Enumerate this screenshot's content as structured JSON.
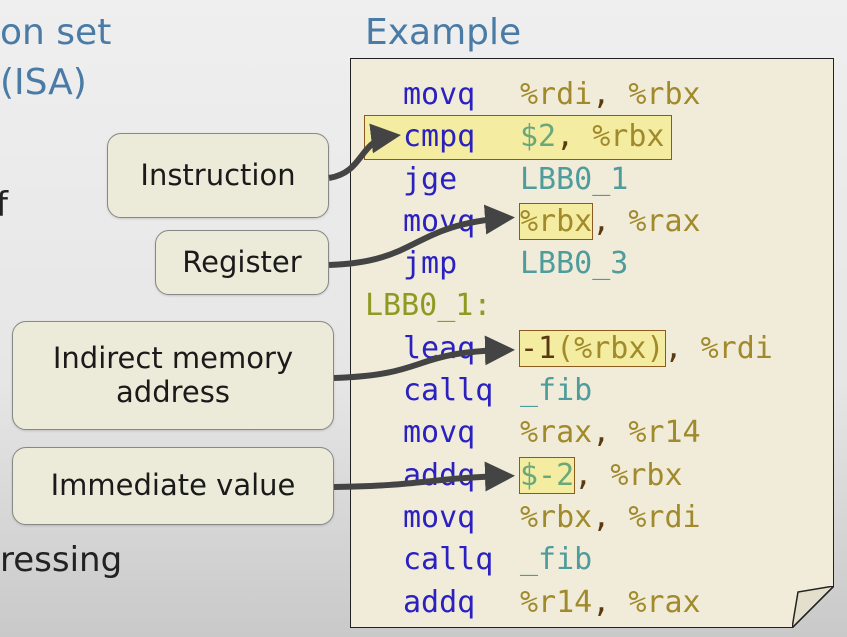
{
  "slide": {
    "left_fragments": [
      "on set",
      "(ISA)",
      "f",
      "ressing"
    ],
    "example_title": "Example"
  },
  "callouts": [
    {
      "label": "Instruction"
    },
    {
      "label": "Register"
    },
    {
      "label": "Indirect memory address"
    },
    {
      "label": "Immediate value"
    }
  ],
  "code": [
    {
      "mnemonic": "movq",
      "tokens": [
        {
          "t": "%rdi",
          "k": "reg"
        },
        {
          "t": ", ",
          "k": "punct"
        },
        {
          "t": "%rbx",
          "k": "reg"
        }
      ]
    },
    {
      "mnemonic": "cmpq",
      "highlight_line": true,
      "tokens": [
        {
          "t": "$2",
          "k": "imm"
        },
        {
          "t": ", ",
          "k": "punct"
        },
        {
          "t": "%rbx",
          "k": "reg"
        }
      ]
    },
    {
      "mnemonic": "jge",
      "tokens": [
        {
          "t": "LBB0_1",
          "k": "lbl"
        }
      ]
    },
    {
      "mnemonic": "movq",
      "tokens": [
        {
          "t": "%rbx",
          "k": "reg",
          "boxed": true
        },
        {
          "t": ", ",
          "k": "punct"
        },
        {
          "t": "%rax",
          "k": "reg"
        }
      ]
    },
    {
      "mnemonic": "jmp",
      "tokens": [
        {
          "t": "LBB0_3",
          "k": "lbl"
        }
      ]
    },
    {
      "label": "LBB0_1:"
    },
    {
      "mnemonic": "leaq",
      "tokens": [
        {
          "t": "-1",
          "k": "num",
          "boxed": true
        },
        {
          "t": "(%rbx)",
          "k": "reg",
          "boxed": true
        },
        {
          "t": ", ",
          "k": "punct"
        },
        {
          "t": "%rdi",
          "k": "reg"
        }
      ]
    },
    {
      "mnemonic": "callq",
      "tokens": [
        {
          "t": "_fib",
          "k": "lbl"
        }
      ]
    },
    {
      "mnemonic": "movq",
      "tokens": [
        {
          "t": "%rax",
          "k": "reg"
        },
        {
          "t": ", ",
          "k": "punct"
        },
        {
          "t": "%r14",
          "k": "reg"
        }
      ]
    },
    {
      "mnemonic": "addq",
      "tokens": [
        {
          "t": "$-2",
          "k": "imm",
          "boxed": true
        },
        {
          "t": ", ",
          "k": "punct"
        },
        {
          "t": "%rbx",
          "k": "reg"
        }
      ]
    },
    {
      "mnemonic": "movq",
      "tokens": [
        {
          "t": "%rbx",
          "k": "reg"
        },
        {
          "t": ", ",
          "k": "punct"
        },
        {
          "t": "%rdi",
          "k": "reg"
        }
      ]
    },
    {
      "mnemonic": "callq",
      "tokens": [
        {
          "t": "_fib",
          "k": "lbl"
        }
      ]
    },
    {
      "mnemonic": "addq",
      "tokens": [
        {
          "t": "%r14",
          "k": "reg"
        },
        {
          "t": ", ",
          "k": "punct"
        },
        {
          "t": "%rax",
          "k": "reg"
        }
      ]
    }
  ],
  "colors": {
    "mnemonic": "#2b20c0",
    "register": "#a08a2c",
    "immediate": "#6aa87c",
    "label": "#4f9c9c",
    "highlight": "#f4eca0",
    "title": "#4a7ba6"
  }
}
